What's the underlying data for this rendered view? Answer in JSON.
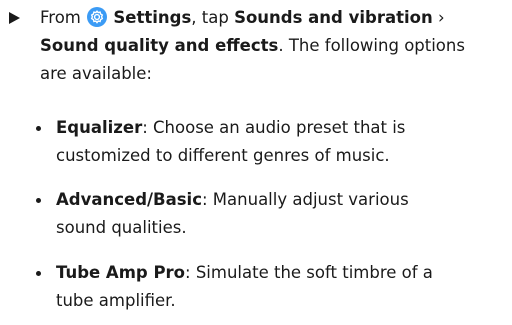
{
  "step": {
    "from": "From",
    "settings_icon": "settings-gear-icon",
    "settings_label": "Settings",
    "tap": ", tap",
    "sounds_label": "Sounds and vibration",
    "chevron": "›",
    "quality_label": "Sound quality and effects",
    "rest1": ". The following options",
    "rest2": "are available:"
  },
  "options": [
    {
      "name": "Equalizer",
      "sep": ":",
      "line1": " Choose an audio preset that is",
      "line2": "customized to different genres of music."
    },
    {
      "name": "Advanced/Basic",
      "sep": ":",
      "line1": " Manually adjust various",
      "line2": "sound qualities."
    },
    {
      "name": "Tube Amp Pro",
      "sep": ":",
      "line1": " Simulate the soft timbre of a",
      "line2": "tube amplifier."
    }
  ],
  "colors": {
    "settings_icon_bg": "#3b9bf5",
    "text": "#1a1a1a"
  }
}
